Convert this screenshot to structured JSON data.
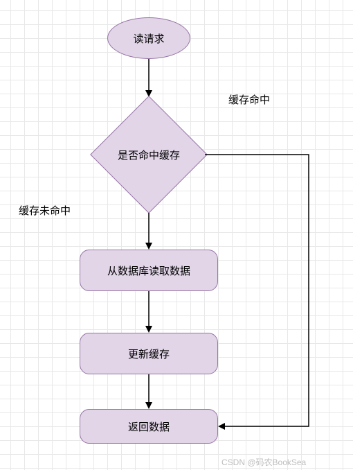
{
  "flow": {
    "start": "读请求",
    "decision": "是否命中缓存",
    "cache_hit_label": "缓存命中",
    "cache_miss_label": "缓存未命中",
    "read_db": "从数据库读取数据",
    "update_cache": "更新缓存",
    "return_data": "返回数据"
  },
  "watermark": "CSDN @码农BookSea",
  "colors": {
    "fill": "#e1d5e7",
    "stroke": "#9673a6"
  }
}
